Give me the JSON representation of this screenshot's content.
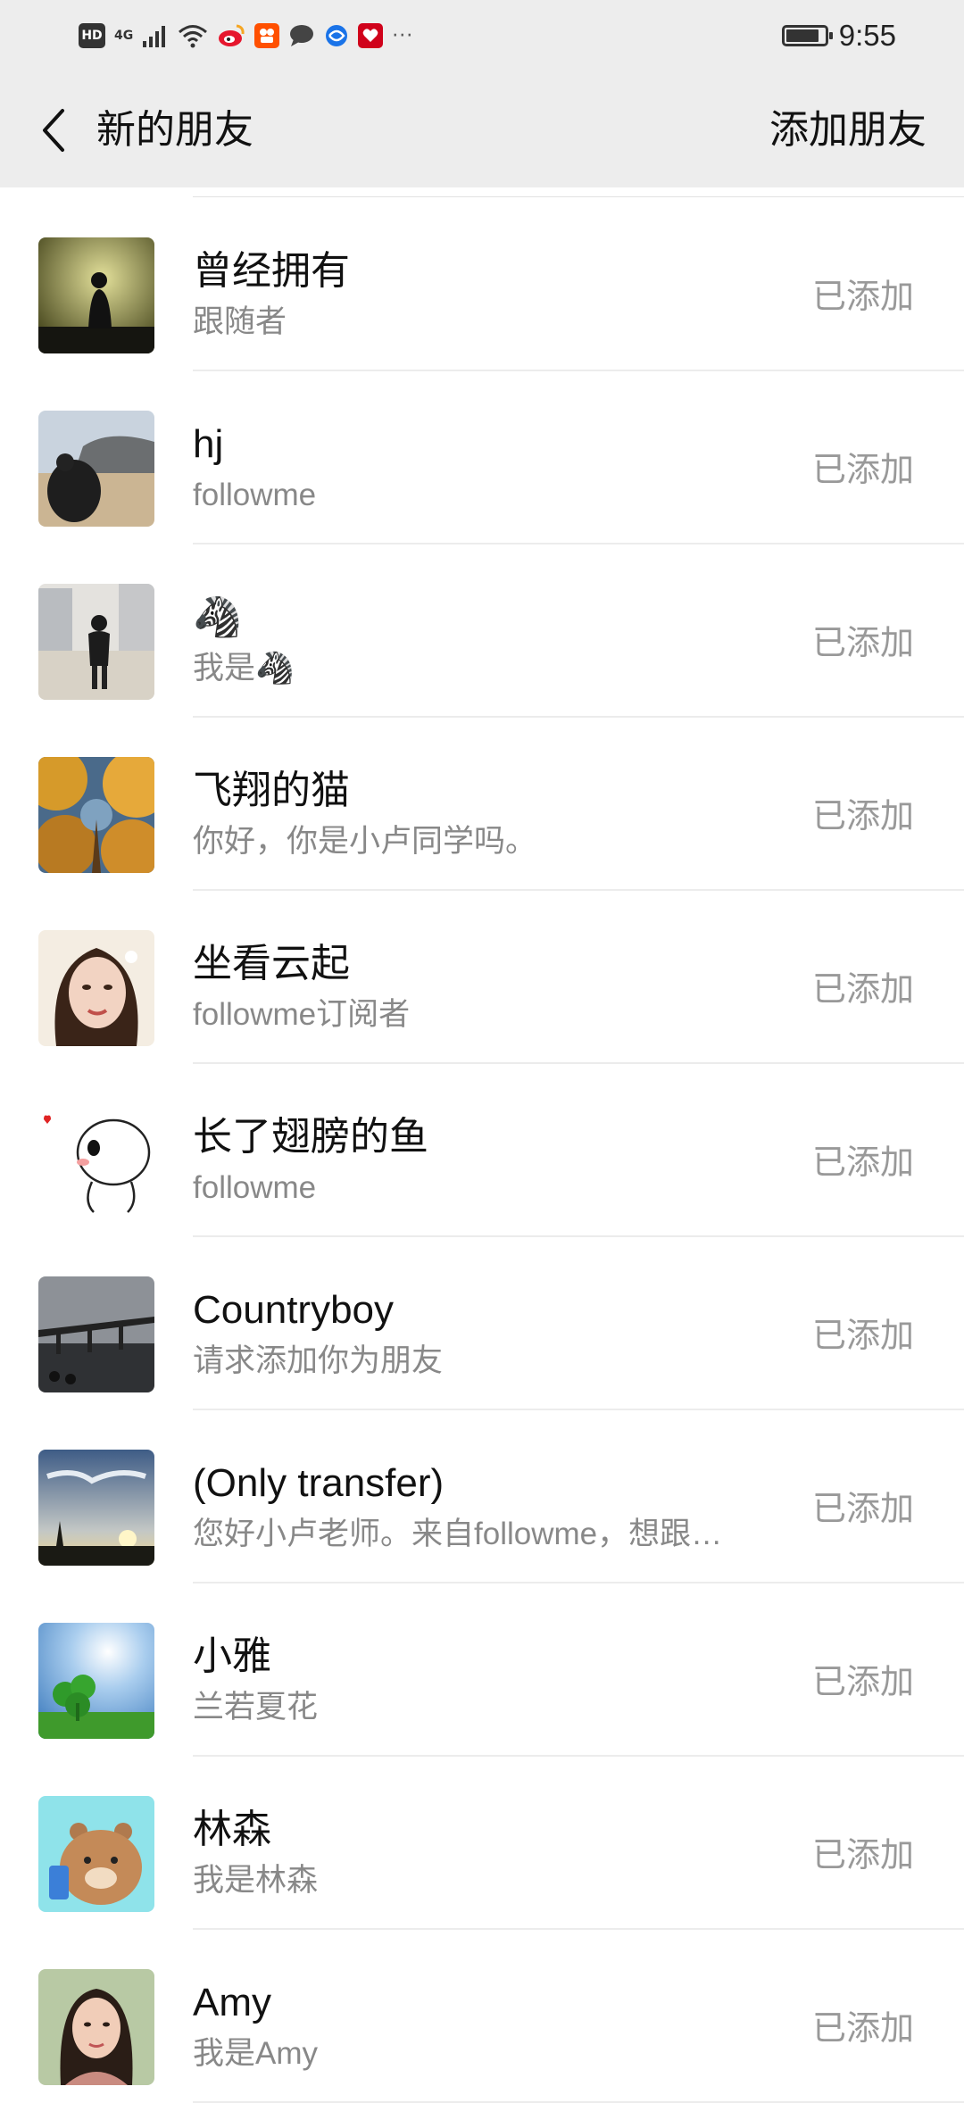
{
  "status_bar": {
    "hd_label": "HD",
    "network_label": "4G",
    "more": "···",
    "time": "9:55",
    "battery_level": 0.85
  },
  "header": {
    "back_icon": "chevron-left-icon",
    "title": "新的朋友",
    "add_friend_label": "添加朋友"
  },
  "friends": [
    {
      "name": "曾经拥有",
      "message": "跟随者",
      "status": "已添加"
    },
    {
      "name": "hj",
      "message": "followme",
      "status": "已添加"
    },
    {
      "name": "🦓",
      "message": "我是🦓",
      "status": "已添加"
    },
    {
      "name": "飞翔的猫",
      "message": "你好，你是小卢同学吗。",
      "status": "已添加"
    },
    {
      "name": "坐看云起",
      "message": "followme订阅者",
      "status": "已添加"
    },
    {
      "name": "长了翅膀的鱼",
      "message": "followme",
      "status": "已添加"
    },
    {
      "name": "Countryboy",
      "message": "请求添加你为朋友",
      "status": "已添加"
    },
    {
      "name": "(Only transfer)",
      "message": "您好小卢老师。来自followme，想跟…",
      "status": "已添加"
    },
    {
      "name": "小雅",
      "message": "兰若夏花",
      "status": "已添加"
    },
    {
      "name": "林森",
      "message": "我是林森",
      "status": "已添加"
    },
    {
      "name": "Amy",
      "message": "我是Amy",
      "status": "已添加"
    }
  ]
}
